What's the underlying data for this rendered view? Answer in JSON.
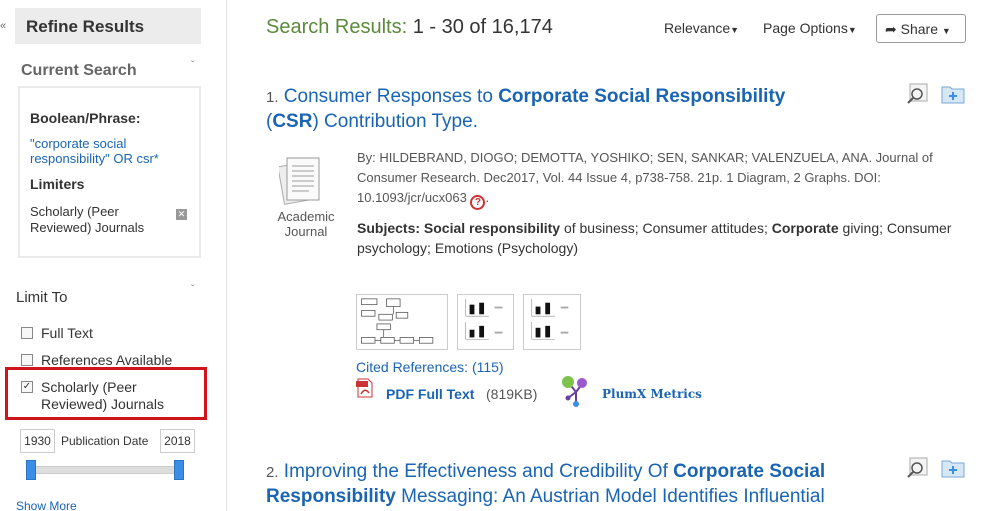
{
  "sidebar": {
    "collapse_glyph": "«",
    "refine_title": "Refine Results",
    "current_search": {
      "header": "Current Search",
      "boolean_label": "Boolean/Phrase:",
      "boolean_value": "\"corporate social responsibility\" OR csr*",
      "limiters_label": "Limiters",
      "limiter_value": "Scholarly (Peer Reviewed) Journals"
    },
    "limit_to": {
      "header": "Limit To",
      "options": [
        {
          "label": "Full Text",
          "checked": false
        },
        {
          "label": "References Available",
          "checked": false
        },
        {
          "label": "Scholarly (Peer Reviewed) Journals",
          "checked": true
        }
      ]
    },
    "pub_date": {
      "start": "1930",
      "label": "Publication Date",
      "end": "2018"
    },
    "show_more": "Show More"
  },
  "header": {
    "results_label": "Search Results:",
    "results_range": "1 - 30 of 16,174",
    "relevance": "Relevance",
    "page_options": "Page Options",
    "share": "Share"
  },
  "results": [
    {
      "number": "1.",
      "title_parts": [
        "Consumer Responses to ",
        "Corporate Social Responsibility",
        " (",
        "CSR",
        ") Contribution Type."
      ],
      "doc_type": "Academic Journal",
      "byline": "By: HILDEBRAND, DIOGO; DEMOTTA, YOSHIKO; SEN, SANKAR; VALENZUELA, ANA. Journal of Consumer Research. Dec2017, Vol. 44 Issue 4, p738-758. 21p. 1 Diagram, 2 Graphs. DOI: 10.1093/jcr/ucx063",
      "subjects_label": "Subjects:",
      "subjects_parts": [
        "Social responsibility",
        " of business; Consumer attitudes; ",
        "Corporate",
        " giving; Consumer psychology; Emotions (Psychology)"
      ],
      "cited_references": "Cited References: (115)",
      "pdf_label": "PDF Full Text",
      "pdf_size": "(819KB)",
      "plumx": "PlumX Metrics"
    },
    {
      "number": "2.",
      "title_parts": [
        "Improving the Effectiveness and Credibility Of ",
        "Corporate Social",
        "Responsibility",
        " Messaging: An Austrian Model Identifies Influential"
      ]
    }
  ],
  "colors": {
    "link": "#1a64b4",
    "heading_green": "#5a8a3a",
    "highlight_red": "#d0141c",
    "slider_blue": "#3a8ee6"
  },
  "icons": [
    "preview-magnifier-icon",
    "add-to-folder-icon",
    "academic-journal-icon",
    "pdf-icon",
    "plumx-icon",
    "doi-icon",
    "remove-limiter-icon"
  ]
}
